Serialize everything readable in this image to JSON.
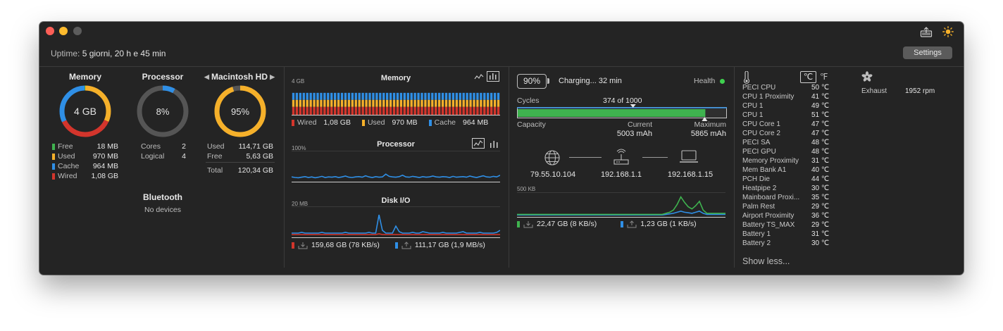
{
  "uptime": {
    "label": "Uptime:",
    "value": "5 giorni, 20 h e 45 min"
  },
  "settings_label": "Settings",
  "memory": {
    "title": "Memory",
    "center": "4 GB",
    "items": [
      {
        "label": "Free",
        "value": "18 MB",
        "color": "#3fb34f"
      },
      {
        "label": "Used",
        "value": "970 MB",
        "color": "#f5b02a"
      },
      {
        "label": "Cache",
        "value": "964 MB",
        "color": "#2f8fe6"
      },
      {
        "label": "Wired",
        "value": "1,08 GB",
        "color": "#d3352c"
      }
    ]
  },
  "processor": {
    "title": "Processor",
    "center": "8%",
    "percent": 8,
    "items": [
      {
        "label": "Cores",
        "value": "2"
      },
      {
        "label": "Logical",
        "value": "4"
      }
    ]
  },
  "disk": {
    "title": "Macintosh HD",
    "center": "95%",
    "percent": 95,
    "items": [
      {
        "label": "Used",
        "value": "114,71 GB"
      },
      {
        "label": "Free",
        "value": "5,63 GB"
      },
      {
        "label": "Total",
        "value": "120,34 GB"
      }
    ]
  },
  "bluetooth": {
    "title": "Bluetooth",
    "status": "No devices"
  },
  "memory_panel": {
    "title": "Memory",
    "scale": "4 GB",
    "legend": [
      {
        "label": "Wired",
        "value": "1,08 GB",
        "color": "#d3352c"
      },
      {
        "label": "Used",
        "value": "970 MB",
        "color": "#f5b02a"
      },
      {
        "label": "Cache",
        "value": "964 MB",
        "color": "#2f8fe6"
      }
    ]
  },
  "processor_panel": {
    "title": "Processor",
    "scale": "100%",
    "series": [
      12,
      10,
      9,
      11,
      13,
      10,
      12,
      9,
      11,
      14,
      10,
      12,
      11,
      13,
      10,
      12,
      15,
      11,
      10,
      12,
      13,
      11,
      16,
      12,
      10,
      13,
      11,
      12,
      22,
      14,
      12,
      11,
      13,
      18,
      12,
      11,
      14,
      12,
      10,
      13,
      11,
      12,
      15,
      12,
      11,
      13,
      12,
      10,
      14,
      11,
      12,
      13,
      11,
      15,
      12,
      10,
      13,
      16,
      12,
      11,
      14,
      12,
      18
    ]
  },
  "disk_panel": {
    "title": "Disk I/O",
    "scale": "20 MB",
    "read_series": [
      4,
      4,
      4,
      5,
      4,
      4,
      4,
      4,
      4,
      5,
      4,
      4,
      4,
      4,
      4,
      4,
      5,
      4,
      4,
      4,
      4,
      4,
      4,
      5,
      4,
      4,
      30,
      8,
      4,
      4,
      4,
      14,
      6,
      4,
      4,
      4,
      5,
      4,
      4,
      6,
      5,
      4,
      4,
      4,
      4,
      5,
      4,
      4,
      4,
      4,
      5,
      6,
      4,
      4,
      4,
      4,
      5,
      4,
      4,
      4,
      4,
      5,
      8
    ],
    "write_series": [
      2,
      2,
      2,
      2,
      2,
      2,
      2,
      2,
      2,
      2,
      2,
      2,
      2,
      2,
      2,
      2,
      2,
      2,
      2,
      2,
      2,
      2,
      2,
      2,
      2,
      2,
      3,
      2,
      2,
      2,
      2,
      2,
      2,
      2,
      2,
      2,
      2,
      2,
      2,
      2,
      2,
      2,
      2,
      2,
      2,
      2,
      2,
      2,
      2,
      2,
      2,
      2,
      2,
      2,
      2,
      2,
      2,
      2,
      2,
      2,
      2,
      2,
      2
    ],
    "read_label": "159,68 GB (78 KB/s)",
    "write_label": "111,17 GB (1,9 MB/s)"
  },
  "battery": {
    "percent": "90%",
    "status": "Charging... 32 min",
    "health_label": "Health",
    "health_color": "#3fd14f",
    "cycles_label": "Cycles",
    "cycles_value": "374 of 1000",
    "capacity_label": "Capacity",
    "current_label": "Current",
    "current_value": "5003 mAh",
    "maximum_label": "Maximum",
    "maximum_value": "5865 mAh",
    "charge_fraction": 0.9,
    "cycles_fraction": 0.374
  },
  "network": {
    "public_ip": "79.55.10.104",
    "router_ip": "192.168.1.1",
    "local_ip": "192.168.1.15",
    "scale": "500 KB",
    "download_series": [
      2,
      2,
      2,
      2,
      2,
      2,
      2,
      2,
      2,
      2,
      2,
      2,
      2,
      2,
      2,
      2,
      2,
      2,
      2,
      2,
      2,
      2,
      2,
      2,
      2,
      2,
      2,
      2,
      2,
      2,
      2,
      2,
      2,
      2,
      2,
      2,
      2,
      2,
      2,
      2,
      4,
      6,
      10,
      20,
      34,
      24,
      16,
      12,
      18,
      26,
      10,
      4,
      4,
      4,
      4,
      4,
      4
    ],
    "upload_series": [
      1,
      1,
      1,
      1,
      1,
      1,
      1,
      1,
      1,
      1,
      1,
      1,
      1,
      1,
      1,
      1,
      1,
      1,
      1,
      1,
      1,
      1,
      1,
      1,
      1,
      1,
      1,
      1,
      1,
      1,
      1,
      1,
      1,
      1,
      1,
      1,
      1,
      1,
      1,
      1,
      2,
      3,
      4,
      6,
      8,
      6,
      5,
      4,
      6,
      8,
      4,
      2,
      2,
      2,
      2,
      2,
      2
    ],
    "download_label": "22,47 GB (8 KB/s)",
    "upload_label": "1,23 GB (1 KB/s)"
  },
  "sensors": {
    "unit_c": "℃",
    "unit_f": "℉",
    "items": [
      {
        "name": "PECI CPU",
        "value": "50 ℃"
      },
      {
        "name": "CPU 1 Proximity",
        "value": "41 ℃"
      },
      {
        "name": "CPU 1",
        "value": "49 ℃"
      },
      {
        "name": "CPU 1",
        "value": "51 ℃"
      },
      {
        "name": "CPU Core 1",
        "value": "47 ℃"
      },
      {
        "name": "CPU Core 2",
        "value": "47 ℃"
      },
      {
        "name": "PECI SA",
        "value": "48 ℃"
      },
      {
        "name": "PECI GPU",
        "value": "48 ℃"
      },
      {
        "name": "Memory Proximity",
        "value": "31 ℃"
      },
      {
        "name": "Mem Bank A1",
        "value": "40 ℃"
      },
      {
        "name": "PCH Die",
        "value": "44 ℃"
      },
      {
        "name": "Heatpipe 2",
        "value": "30 ℃"
      },
      {
        "name": "Mainboard Proxi...",
        "value": "35 ℃"
      },
      {
        "name": "Palm Rest",
        "value": "29 ℃"
      },
      {
        "name": "Airport Proximity",
        "value": "36 ℃"
      },
      {
        "name": "Battery TS_MAX",
        "value": "29 ℃"
      },
      {
        "name": "Battery 1",
        "value": "31 ℃"
      },
      {
        "name": "Battery 2",
        "value": "30 ℃"
      }
    ],
    "show_less": "Show less..."
  },
  "fan": {
    "name": "Exhaust",
    "value": "1952 rpm"
  }
}
